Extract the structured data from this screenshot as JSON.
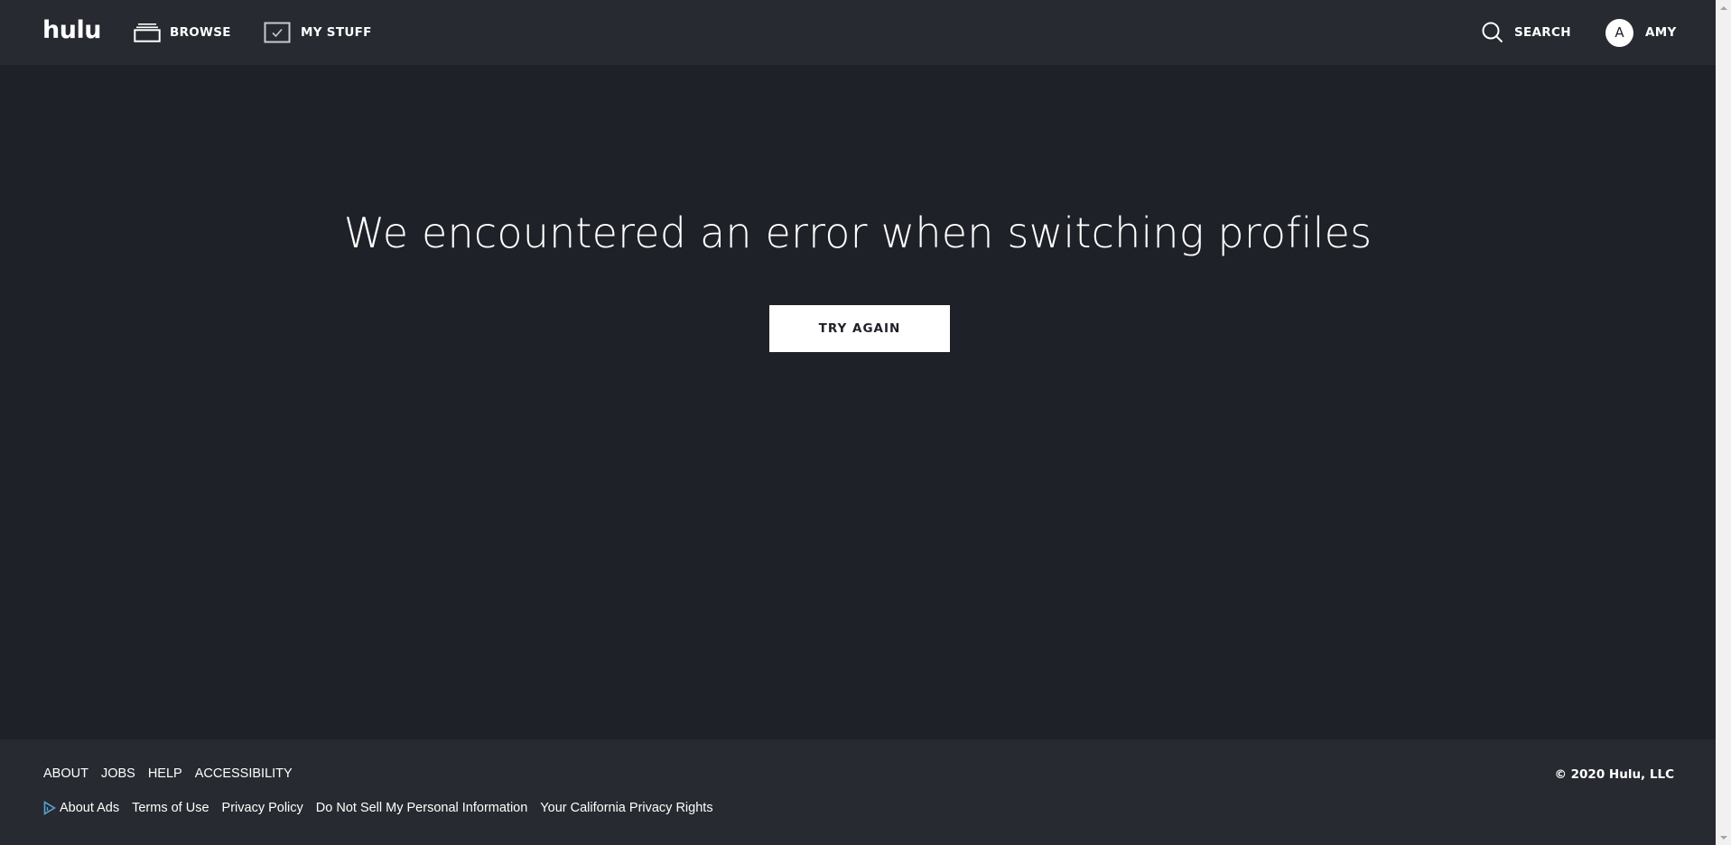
{
  "header": {
    "logo": "hulu",
    "nav": [
      {
        "label": "BROWSE",
        "icon": "browse-stack-icon"
      },
      {
        "label": "MY STUFF",
        "icon": "checkbox-check-icon"
      }
    ],
    "search": {
      "label": "SEARCH",
      "icon": "search-icon"
    },
    "profile": {
      "initial": "A",
      "name": "AMY"
    }
  },
  "main": {
    "title": "We encountered an error when switching profiles",
    "try_again_label": "TRY AGAIN"
  },
  "footer": {
    "primary_links": [
      "ABOUT",
      "JOBS",
      "HELP",
      "ACCESSIBILITY"
    ],
    "secondary_links": [
      {
        "label": "About Ads",
        "icon": "adchoices-icon"
      },
      {
        "label": "Terms of Use"
      },
      {
        "label": "Privacy Policy"
      },
      {
        "label": "Do Not Sell My Personal Information"
      },
      {
        "label": "Your California Privacy Rights"
      }
    ],
    "copyright": "© 2020 Hulu, LLC"
  },
  "colors": {
    "header_bg": "#272a30",
    "page_bg": "#1f2128",
    "footer_bg": "#272a30",
    "button_bg": "#ffffff",
    "adchoices_accent": "#5aa0d6"
  }
}
